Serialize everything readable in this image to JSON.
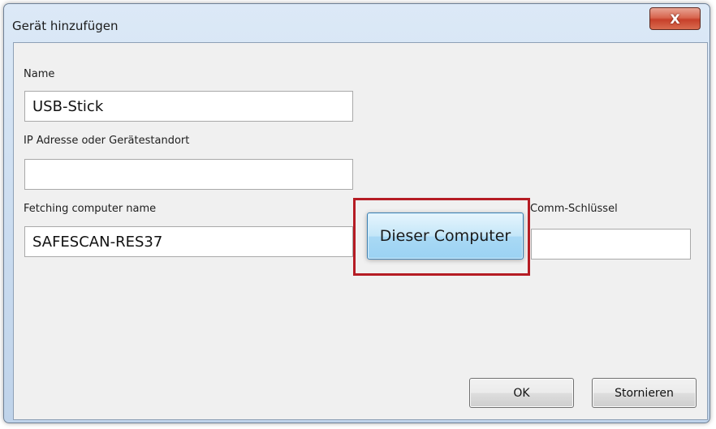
{
  "window": {
    "title": "Gerät hinzufügen",
    "close_glyph": "X"
  },
  "form": {
    "name_label": "Name",
    "name_value": "USB-Stick",
    "ip_label": "IP Adresse oder Gerätestandort",
    "ip_value": "",
    "computer_label": "Fetching computer name",
    "computer_value": "SAFESCAN-RES37",
    "comm_label": "Comm-Schlüssel",
    "comm_value": ""
  },
  "buttons": {
    "this_computer": "Dieser Computer",
    "ok": "OK",
    "cancel": "Stornieren"
  },
  "colors": {
    "highlight_frame": "#b51c24",
    "close_button": "#c7402a",
    "primary_button": "#a9d9f5"
  }
}
